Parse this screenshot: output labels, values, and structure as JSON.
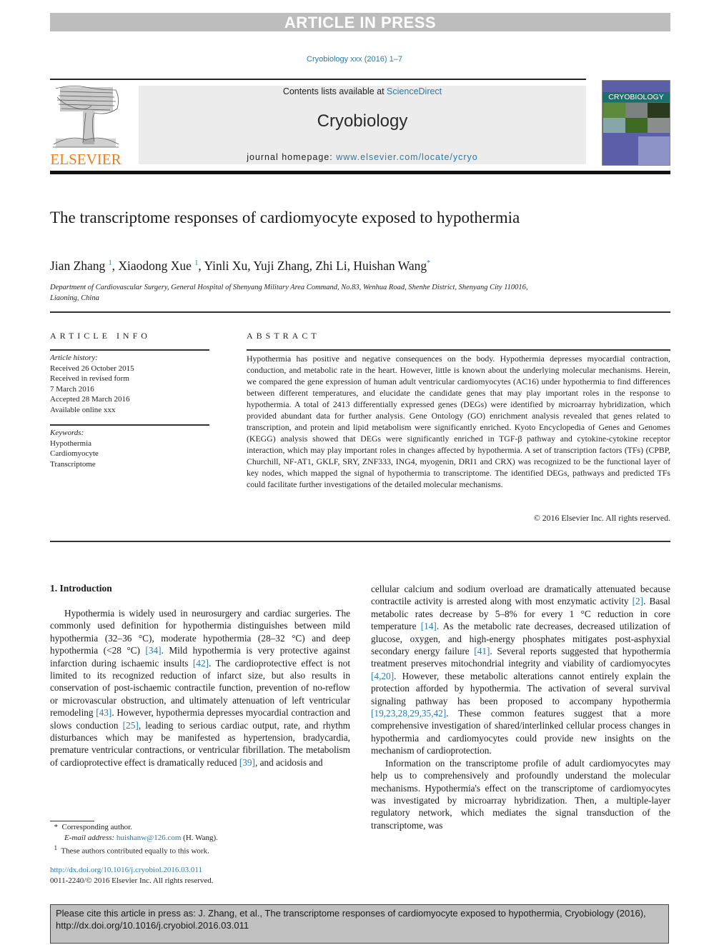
{
  "banner": {
    "label": "ARTICLE IN PRESS"
  },
  "journal_ref": "Cryobiology xxx (2016) 1–7",
  "masthead": {
    "publisher_logo_text": "ELSEVIER",
    "contents_prefix": "Contents lists available at ",
    "contents_link": "ScienceDirect",
    "journal_name": "Cryobiology",
    "homepage_prefix": "journal homepage: ",
    "homepage_url": "www.elsevier.com/locate/ycryo",
    "cover_title": "CRYOBIOLOGY"
  },
  "article": {
    "title": "The transcriptome responses of cardiomyocyte exposed to hypothermia",
    "authors": [
      {
        "name": "Jian Zhang",
        "mark": "1"
      },
      {
        "name": "Xiaodong Xue",
        "mark": "1"
      },
      {
        "name": "Yinli Xu",
        "mark": ""
      },
      {
        "name": "Yuji Zhang",
        "mark": ""
      },
      {
        "name": "Zhi Li",
        "mark": ""
      },
      {
        "name": "Huishan Wang",
        "mark": "*"
      }
    ],
    "affiliation_line1": "Department of Cardiovascular Surgery, General Hospital of Shenyang Military Area Command, No.83, Wenhua Road, Shenhe District, Shenyang City 110016,",
    "affiliation_line2": "Liaoning, China"
  },
  "article_info": {
    "heading": "ARTICLE INFO",
    "history_label": "Article history:",
    "history": [
      "Received 26 October 2015",
      "Received in revised form",
      "7 March 2016",
      "Accepted 28 March 2016",
      "Available online xxx"
    ],
    "keywords_label": "Keywords:",
    "keywords": [
      "Hypothermia",
      "Cardiomyocyte",
      "Transcriptome"
    ]
  },
  "abstract": {
    "heading": "ABSTRACT",
    "text": "Hypothermia has positive and negative consequences on the body. Hypothermia depresses myocardial contraction, conduction, and metabolic rate in the heart. However, little is known about the underlying molecular mechanisms. Herein, we compared the gene expression of human adult ventricular cardiomyocytes (AC16) under hypothermia to find differences between different temperatures, and elucidate the candidate genes that may play important roles in the response to hypothermia. A total of 2413 differentially expressed genes (DEGs) were identified by microarray hybridization, which provided abundant data for further analysis. Gene Ontology (GO) enrichment analysis revealed that genes related to transcription, and protein and lipid metabolism were significantly enriched. Kyoto Encyclopedia of Genes and Genomes (KEGG) analysis showed that DEGs were significantly enriched in TGF-β pathway and cytokine-cytokine receptor interaction, which may play important roles in changes affected by hypothermia. A set of transcription factors (TFs) (CPBP, Churchill, NF-AT1, GKLF, SRY, ZNF333, ING4, myogenin, DRI1 and CRX) was recognized to be the functional layer of key nodes, which mapped the signal of hypothermia to transcriptome. The identified DEGs, pathways and predicted TFs could facilitate further investigations of the detailed molecular mechanisms.",
    "copyright": "© 2016 Elsevier Inc. All rights reserved."
  },
  "introduction": {
    "heading": "1.  Introduction",
    "left_col": [
      {
        "t": "Hypothermia is widely used in neurosurgery and cardiac surgeries. The commonly used definition for hypothermia distinguishes between mild hypothermia (32–36 °C), moderate hypothermia (28–32 °C) and deep hypothermia (<28 °C) "
      },
      {
        "c": "[34]"
      },
      {
        "t": ". Mild hypothermia is very protective against infarction during ischaemic insults "
      },
      {
        "c": "[42]"
      },
      {
        "t": ". The cardioprotective effect is not limited to its recognized reduction of infarct size, but also results in conservation of post-ischaemic contractile function, prevention of no-reflow or microvascular obstruction, and ultimately attenuation of left ventricular remodeling "
      },
      {
        "c": "[43]"
      },
      {
        "t": ". However, hypothermia depresses myocardial contraction and slows conduction "
      },
      {
        "c": "[25]"
      },
      {
        "t": ", leading to serious cardiac output, rate, and rhythm disturbances which may be manifested as hypertension, bradycardia, premature ventricular contractions, or ventricular fibrillation. The metabolism of cardioprotective effect is dramatically reduced "
      },
      {
        "c": "[39]"
      },
      {
        "t": ", and acidosis and"
      }
    ],
    "right_col_p1": [
      {
        "t": "cellular calcium and sodium overload are dramatically attenuated because contractile activity is arrested along with most enzymatic activity "
      },
      {
        "c": "[2]"
      },
      {
        "t": ". Basal metabolic rates decrease by 5–8% for every 1 °C reduction in core temperature "
      },
      {
        "c": "[14]"
      },
      {
        "t": ". As the metabolic rate decreases, decreased utilization of glucose, oxygen, and high-energy phosphates mitigates post-asphyxial secondary energy failure "
      },
      {
        "c": "[41]"
      },
      {
        "t": ". Several reports suggested that hypothermia treatment preserves mitochondrial integrity and viability of cardiomyocytes "
      },
      {
        "c": "[4,20]"
      },
      {
        "t": ". However, these metabolic alterations cannot entirely explain the protection afforded by hypothermia. The activation of several survival signaling pathway has been proposed to accompany hypothermia "
      },
      {
        "c": "[19,23,28,29,35,42]"
      },
      {
        "t": ". These common features suggest that a more comprehensive investigation of shared/interlinked cellular process changes in hypothermia and cardiomyocytes could provide new insights on the mechanism of cardioprotection."
      }
    ],
    "right_col_p2": "Information on the transcriptome profile of adult cardiomyocytes may help us to comprehensively and profoundly understand the molecular mechanisms. Hypothermia's effect on the transcriptome of cardiomyocytes was investigated by microarray hybridization. Then, a multiple-layer regulatory network, which mediates the signal transduction of the transcriptome, was"
  },
  "footnotes": {
    "corresponding_mark": "*",
    "corresponding": "Corresponding author.",
    "email_label": "E-mail address:",
    "email": "huishanw@126.com",
    "email_suffix": "(H. Wang).",
    "equal_mark": "1",
    "equal": "These authors contributed equally to this work."
  },
  "doi": {
    "url": "http://dx.doi.org/10.1016/j.cryobiol.2016.03.011",
    "issn_line": "0011-2240/© 2016 Elsevier Inc. All rights reserved."
  },
  "citation_box": {
    "line1": "Please cite this article in press as: J. Zhang, et al., The transcriptome responses of cardiomyocyte exposed to hypothermia, Cryobiology (2016),",
    "line2": "http://dx.doi.org/10.1016/j.cryobiol.2016.03.011"
  },
  "colors": {
    "link": "#2a7ab0",
    "publisher_orange": "#f07d1a",
    "banner_gray": "#bdbdbd",
    "cite_box_gray": "#c0c0c0"
  }
}
